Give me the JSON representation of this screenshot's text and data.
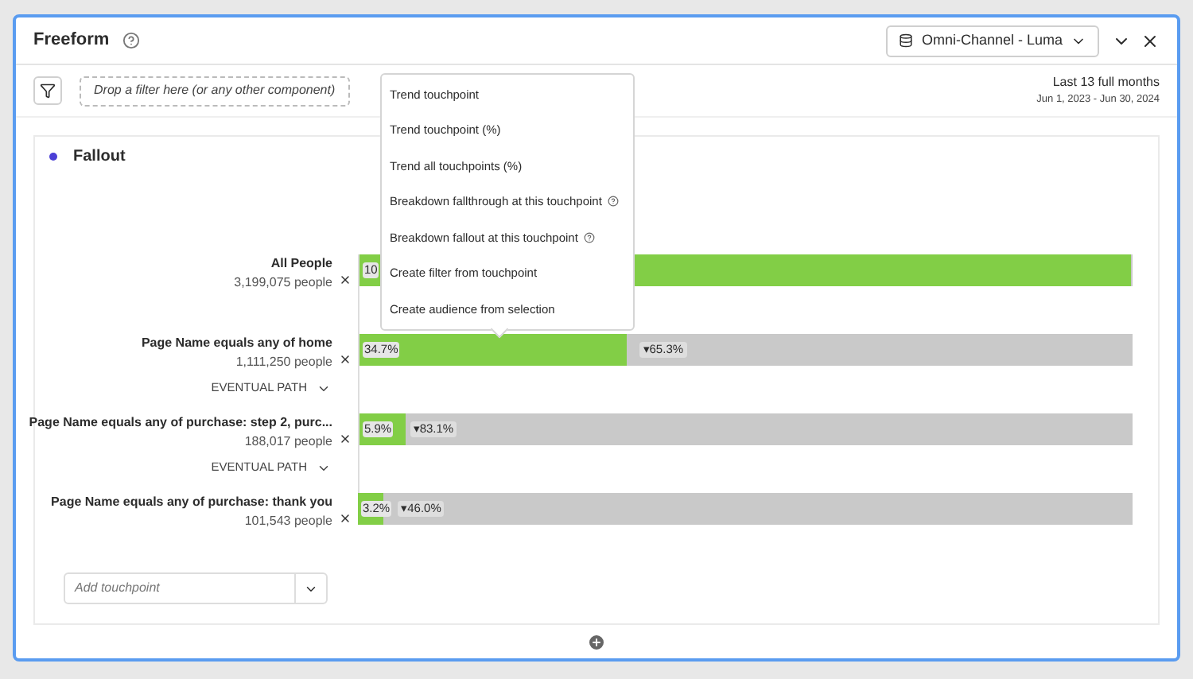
{
  "panel": {
    "title": "Freeform",
    "data_view": "Omni-Channel - Luma"
  },
  "toolbar": {
    "filter_drop_placeholder": "Drop a filter here (or any other component)",
    "date_label": "Last 13 full months",
    "date_range": "Jun 1, 2023 - Jun 30, 2024"
  },
  "fallout": {
    "title": "Fallout",
    "touchpoints": [
      {
        "name": "All People",
        "count": "3,199,075 people",
        "level": 1,
        "percent": "10"
      },
      {
        "name": "Page Name equals any of home",
        "count": "1,111,250 people",
        "level": 0.347,
        "percent": "34.7%",
        "fallout": "▾65.3%",
        "path": "EVENTUAL PATH"
      },
      {
        "name": "Page Name equals any of purchase: step 2, purc...",
        "count": "188,017 people",
        "level": 0.059,
        "percent": "5.9%",
        "fallout": "▾83.1%",
        "path": "EVENTUAL PATH"
      },
      {
        "name": "Page Name equals any of purchase: thank you",
        "count": "101,543 people",
        "level": 0.032,
        "percent": "3.2%",
        "fallout": "▾46.0%"
      }
    ],
    "add_touchpoint_placeholder": "Add touchpoint"
  },
  "context_menu": {
    "items": [
      {
        "label": "Trend touchpoint",
        "info": false
      },
      {
        "label": "Trend touchpoint (%)",
        "info": false
      },
      {
        "label": "Trend all touchpoints (%)",
        "info": false
      },
      {
        "label": "Breakdown fallthrough at this touchpoint",
        "info": true
      },
      {
        "label": "Breakdown fallout at this touchpoint",
        "info": true
      },
      {
        "label": "Create filter from touchpoint",
        "info": false
      },
      {
        "label": "Create audience from selection",
        "info": false
      }
    ]
  }
}
